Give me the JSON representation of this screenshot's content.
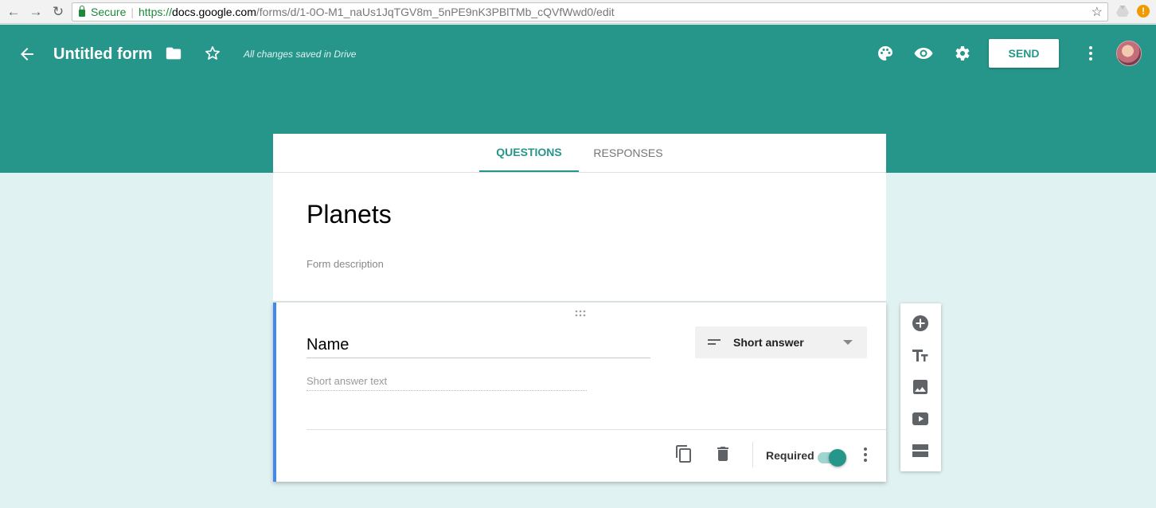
{
  "browser": {
    "secure_label": "Secure",
    "url_scheme": "https://",
    "url_host": "docs.google.com",
    "url_path": "/forms/d/1-0O-M1_naUs1JqTGV8m_5nPE9nK3PBlTMb_cQVfWwd0/edit",
    "alert_badge": "!"
  },
  "header": {
    "form_title": "Untitled form",
    "save_status": "All changes saved in Drive",
    "send_label": "SEND",
    "brand_color": "#26968a"
  },
  "tabs": [
    {
      "label": "QUESTIONS",
      "active": true
    },
    {
      "label": "RESPONSES",
      "active": false
    }
  ],
  "form": {
    "title": "Planets",
    "description_placeholder": "Form description"
  },
  "question": {
    "title": "Name",
    "answer_placeholder": "Short answer text",
    "type": "Short answer",
    "required_label": "Required",
    "required": true
  },
  "toolbar": {
    "icons": [
      "add-question-icon",
      "add-title-icon",
      "add-image-icon",
      "add-video-icon",
      "add-section-icon"
    ]
  }
}
